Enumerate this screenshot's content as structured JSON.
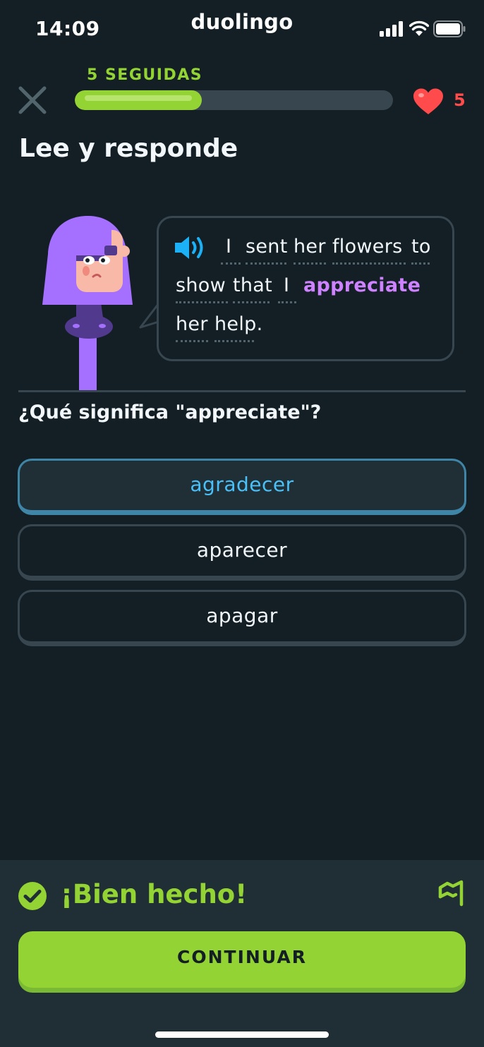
{
  "status_bar": {
    "time": "14:09",
    "app_name": "duolingo",
    "icons": [
      "signal-icon",
      "wifi-icon",
      "battery-icon"
    ]
  },
  "header": {
    "streak_label": "5 SEGUIDAS",
    "progress": 0.4,
    "hearts": "5",
    "icons": [
      "close-icon",
      "heart-icon"
    ]
  },
  "title": "Lee y responde",
  "sentence": {
    "words": [
      "I",
      "sent",
      "her",
      "flowers",
      "to",
      "show",
      "that",
      "I",
      "appreciate",
      "her",
      "help."
    ],
    "highlighted_word": "appreciate",
    "icon": "speaker-icon"
  },
  "question": "¿Qué significa \"appreciate\"?",
  "options": [
    {
      "label": "agradecer",
      "selected": true
    },
    {
      "label": "aparecer",
      "selected": false
    },
    {
      "label": "apagar",
      "selected": false
    }
  ],
  "footer": {
    "feedback": "¡Bien hecho!",
    "continue_label": "CONTINUAR",
    "icons": [
      "check-circle-icon",
      "flag-icon"
    ]
  },
  "colors": {
    "background": "#131f24",
    "panel": "#202f36",
    "border": "#37464f",
    "green": "#93d333",
    "blue": "#49c0f8",
    "purple": "#ce82ff",
    "red": "#ff4b4b"
  }
}
